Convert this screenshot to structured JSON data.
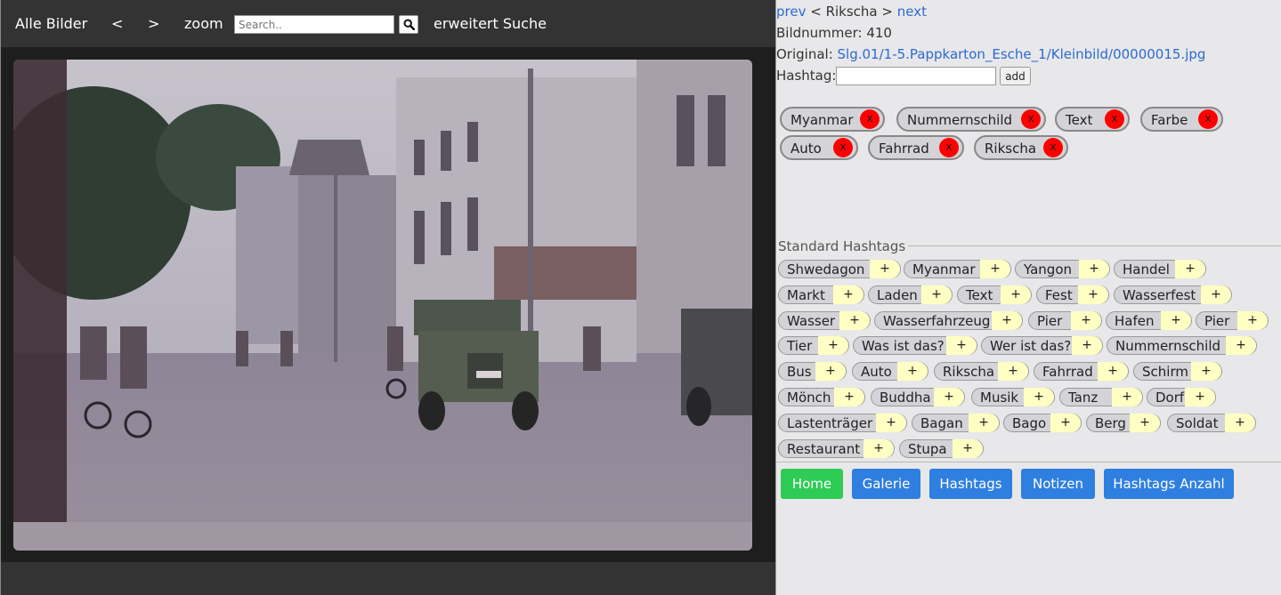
{
  "topbar": {
    "all_images": "Alle Bilder",
    "prev": "<",
    "next": ">",
    "zoom": "zoom",
    "search_placeholder": "Search..",
    "advanced_search": "erweitert Suche"
  },
  "photo": {
    "icon": "photo-street-scene",
    "colors": {
      "sky": "#b9b6c2",
      "road": "#8b8396",
      "building": "#a8a2ad",
      "trees": "#334433",
      "jeep": "#4a5347"
    }
  },
  "info": {
    "prev_link": "prev",
    "breadcrumb_mid": " < Rikscha > ",
    "next_link": "next",
    "image_number": "Bildnummer: 410",
    "original_label": "Original: ",
    "original_path": "Slg.01/1-5.Pappkarton_Esche_1/Kleinbild/00000015.jpg",
    "hashtag_label": "Hashtag:",
    "add_button": "add"
  },
  "current_tags": [
    {
      "label": "Myanmar",
      "remove": "x"
    },
    {
      "label": "Nummernschild",
      "remove": "x"
    },
    {
      "label": "Text",
      "remove": "x"
    },
    {
      "label": "Farbe",
      "remove": "x"
    },
    {
      "label": "Auto",
      "remove": "x"
    },
    {
      "label": "Fahrrad",
      "remove": "x"
    },
    {
      "label": "Rikscha",
      "remove": "x"
    }
  ],
  "standard_title": "Standard Hashtags",
  "standard_tags": [
    {
      "label": "Shwedagon",
      "add": "+"
    },
    {
      "label": "Myanmar",
      "add": "+"
    },
    {
      "label": "Yangon",
      "add": "+"
    },
    {
      "label": "Handel",
      "add": "+"
    },
    {
      "label": "Markt",
      "add": "+"
    },
    {
      "label": "Laden",
      "add": "+"
    },
    {
      "label": "Text",
      "add": "+"
    },
    {
      "label": "Fest",
      "add": "+"
    },
    {
      "label": "Wasserfest",
      "add": "+"
    },
    {
      "label": "Wasser",
      "add": "+"
    },
    {
      "label": "Wasserfahrzeug",
      "add": "+"
    },
    {
      "label": "Pier",
      "add": "+"
    },
    {
      "label": "Hafen",
      "add": "+"
    },
    {
      "label": "Pier",
      "add": "+"
    },
    {
      "label": "Tier",
      "add": "+"
    },
    {
      "label": "Was ist das?",
      "add": "+"
    },
    {
      "label": "Wer ist das?",
      "add": "+"
    },
    {
      "label": "Nummernschild",
      "add": "+"
    },
    {
      "label": "Bus",
      "add": "+"
    },
    {
      "label": "Auto",
      "add": "+"
    },
    {
      "label": "Rikscha",
      "add": "+"
    },
    {
      "label": "Fahrrad",
      "add": "+"
    },
    {
      "label": "Schirm",
      "add": "+"
    },
    {
      "label": "Mönch",
      "add": "+"
    },
    {
      "label": "Buddha",
      "add": "+"
    },
    {
      "label": "Musik",
      "add": "+"
    },
    {
      "label": "Tanz",
      "add": "+"
    },
    {
      "label": "Dorf",
      "add": "+"
    },
    {
      "label": "Lastenträger",
      "add": "+"
    },
    {
      "label": "Bagan",
      "add": "+"
    },
    {
      "label": "Bago",
      "add": "+"
    },
    {
      "label": "Berg",
      "add": "+"
    },
    {
      "label": "Soldat",
      "add": "+"
    },
    {
      "label": "Restaurant",
      "add": "+"
    },
    {
      "label": "Stupa",
      "add": "+"
    }
  ],
  "buttons": [
    {
      "label": "Home",
      "color": "#2ecc55"
    },
    {
      "label": "Galerie",
      "color": "#2f7fe0"
    },
    {
      "label": "Hashtags",
      "color": "#2f7fe0"
    },
    {
      "label": "Notizen",
      "color": "#2f7fe0"
    },
    {
      "label": "Hashtags Anzahl",
      "color": "#2f7fe0"
    }
  ]
}
